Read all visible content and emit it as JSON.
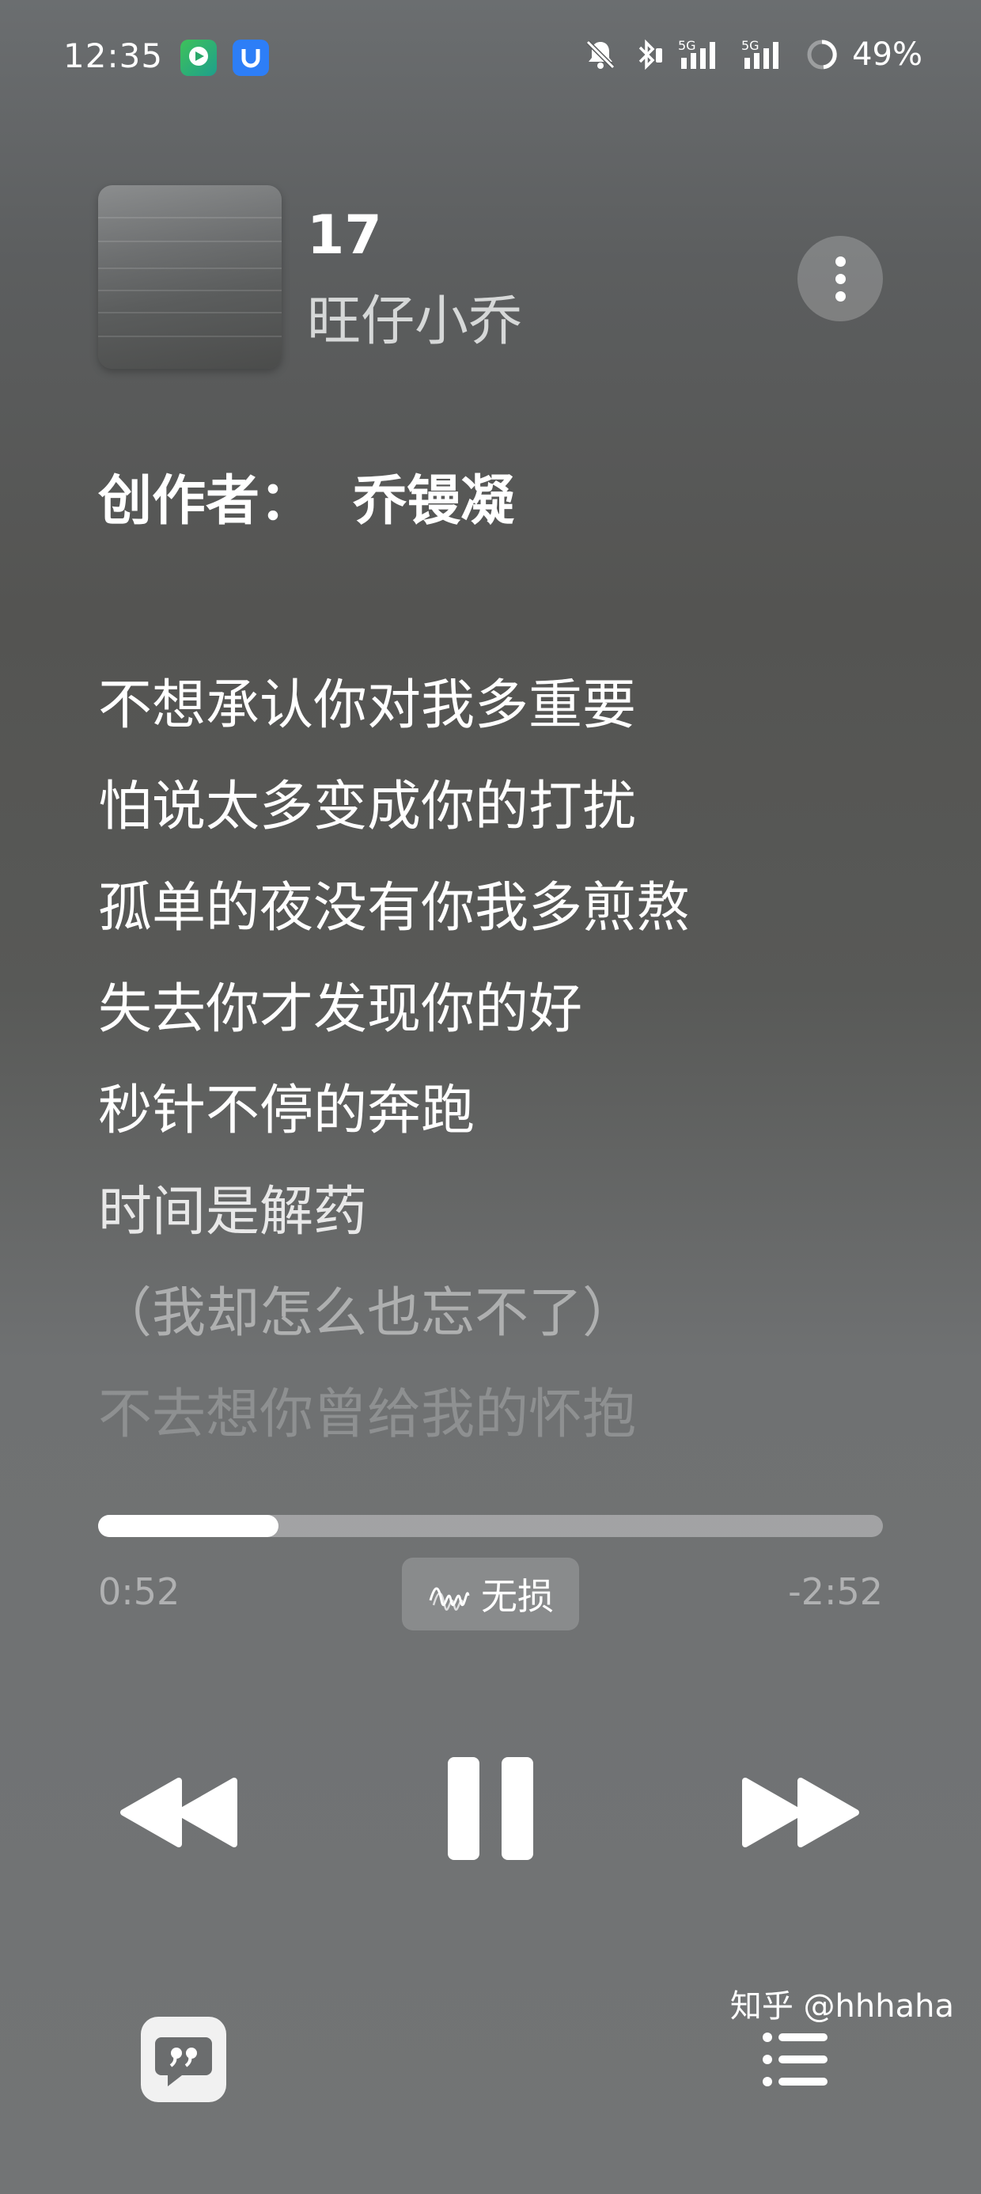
{
  "status_bar": {
    "time": "12:35",
    "battery": "49%",
    "icons": [
      "app-icon-green",
      "app-icon-blue",
      "mute-icon",
      "bluetooth-icon",
      "signal-5g-icon",
      "signal-5g-icon",
      "battery-ring-icon"
    ]
  },
  "song": {
    "title": "17",
    "artist": "旺仔小乔"
  },
  "lyrics": {
    "credit_label": "创作者：",
    "credit_name": "乔镘凝",
    "lines": [
      "不想承认你对我多重要",
      "怕说太多变成你的打扰",
      "孤单的夜没有你我多煎熬",
      "失去你才发现你的好",
      "秒针不停的奔跑",
      "时间是解药",
      "（我却怎么也忘不了）",
      "不去想你曾给我的怀抱"
    ]
  },
  "playback": {
    "elapsed": "0:52",
    "remaining": "-2:52",
    "progress_fraction": 0.23,
    "quality_label": "无损"
  },
  "controls": [
    "rewind-icon",
    "pause-icon",
    "fast-forward-icon",
    "lyrics-bubble-icon",
    "queue-list-icon"
  ],
  "watermark": "知乎 @hhhaha",
  "colors": {
    "accent": "#ffffff",
    "app_green": "#34b34a",
    "app_blue": "#2d7ef7"
  }
}
